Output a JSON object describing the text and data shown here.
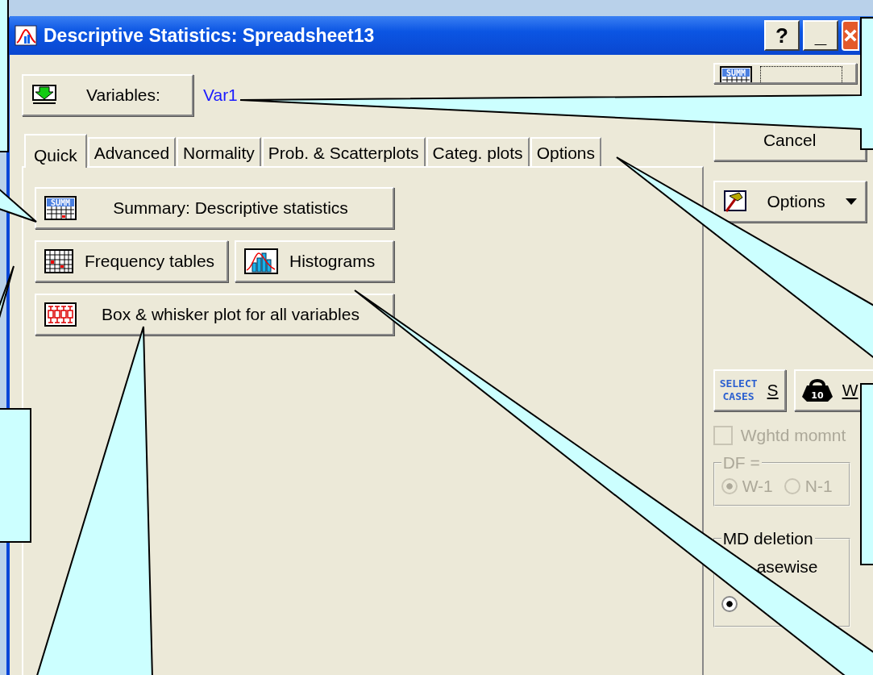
{
  "window": {
    "title": "Descriptive Statistics: Spreadsheet13",
    "title_buttons": [
      "?",
      "_"
    ]
  },
  "variables": {
    "button": "Variables:",
    "value": "Var1"
  },
  "tabs": [
    {
      "label": "Quick",
      "selected": true
    },
    {
      "label": "Advanced",
      "selected": false
    },
    {
      "label": "Normality",
      "selected": false
    },
    {
      "label": "Prob. & Scatterplots",
      "selected": false
    },
    {
      "label": "Categ. plots",
      "selected": false
    },
    {
      "label": "Options",
      "selected": false
    }
  ],
  "quick_buttons": [
    {
      "label": "Summary: Descriptive statistics",
      "kind": "summary",
      "icon_text": "SUMM"
    },
    {
      "label": "Frequency tables",
      "kind": "frequency"
    },
    {
      "label": "Histograms",
      "kind": "histogram"
    },
    {
      "label": "Box & whisker plot for all variables",
      "kind": "boxplot"
    }
  ],
  "side": {
    "summary_icon_text": "SUMM",
    "cancel": "Cancel",
    "options": "Options",
    "select_cases": {
      "icon_text": [
        "SELECT",
        "CASES"
      ],
      "label": "S"
    },
    "weight": {
      "icon_text": "10",
      "label": "W"
    },
    "weighted": {
      "label": "Wghtd momnt",
      "checked": false,
      "disabled": true
    },
    "df": {
      "legend": "DF =",
      "disabled": true,
      "options": [
        {
          "label": "W-1",
          "selected": true
        },
        {
          "label": "N-1",
          "selected": false
        }
      ]
    },
    "md": {
      "legend": "MD deletion",
      "partial_label": "asewise",
      "options": [
        {
          "selected": true
        }
      ]
    }
  }
}
